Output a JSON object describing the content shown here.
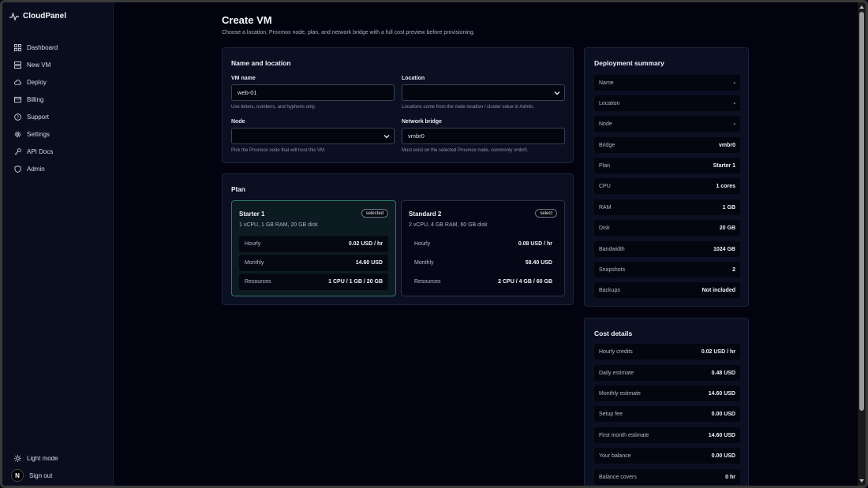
{
  "app": {
    "brand": "CloudPanel"
  },
  "sidebar": {
    "items": [
      {
        "label": "Dashboard",
        "icon": "grid-icon"
      },
      {
        "label": "New VM",
        "icon": "server-icon"
      },
      {
        "label": "Deploy",
        "icon": "cloud-icon"
      },
      {
        "label": "Billing",
        "icon": "card-icon"
      },
      {
        "label": "Support",
        "icon": "help-icon"
      },
      {
        "label": "Settings",
        "icon": "gear-icon"
      },
      {
        "label": "API Docs",
        "icon": "key-icon"
      },
      {
        "label": "Admin",
        "icon": "shield-icon"
      }
    ],
    "bottom": {
      "light_mode": "Light mode",
      "sign_out": "Sign out",
      "avatar_letter": "N"
    }
  },
  "header": {
    "title": "Create VM",
    "subtitle": "Choose a location, Proxmox node, plan, and network bridge with a full cost preview before provisioning."
  },
  "form": {
    "title": "Name and location",
    "vm_name": {
      "label": "VM name",
      "value": "web-01",
      "hint": "Use letters, numbers, and hyphens only."
    },
    "location": {
      "label": "Location",
      "value": "",
      "hint": "Locations come from the node location / cluster value in Admin."
    },
    "node": {
      "label": "Node",
      "value": "",
      "hint": "Pick the Proxmox node that will host this VM."
    },
    "bridge": {
      "label": "Network bridge",
      "value": "vmbr0",
      "hint": "Must exist on the selected Proxmox node, commonly vmbr0."
    }
  },
  "plans": {
    "title": "Plan",
    "items": [
      {
        "name": "Starter 1",
        "badge": "selected",
        "desc": "1 vCPU, 1 GB RAM, 20 GB disk",
        "rows": [
          {
            "k": "Hourly",
            "v": "0.02 USD / hr"
          },
          {
            "k": "Monthly",
            "v": "14.60 USD"
          },
          {
            "k": "Resources",
            "v": "1 CPU / 1 GB / 20 GB"
          }
        ]
      },
      {
        "name": "Standard 2",
        "badge": "select",
        "desc": "2 vCPU, 4 GB RAM, 60 GB disk",
        "rows": [
          {
            "k": "Hourly",
            "v": "0.08 USD / hr"
          },
          {
            "k": "Monthly",
            "v": "58.40 USD"
          },
          {
            "k": "Resources",
            "v": "2 CPU / 4 GB / 60 GB"
          }
        ]
      }
    ]
  },
  "summary": {
    "title": "Deployment summary",
    "rows": [
      {
        "k": "Name",
        "v": "-"
      },
      {
        "k": "Location",
        "v": "-"
      },
      {
        "k": "Node",
        "v": "-"
      },
      {
        "k": "Bridge",
        "v": "vmbr0"
      },
      {
        "k": "Plan",
        "v": "Starter 1"
      },
      {
        "k": "CPU",
        "v": "1 cores"
      },
      {
        "k": "RAM",
        "v": "1 GB"
      },
      {
        "k": "Disk",
        "v": "20 GB"
      },
      {
        "k": "Bandwidth",
        "v": "1024 GB"
      },
      {
        "k": "Snapshots",
        "v": "2"
      },
      {
        "k": "Backups",
        "v": "Not included"
      }
    ]
  },
  "costs": {
    "title": "Cost details",
    "rows": [
      {
        "k": "Hourly credits",
        "v": "0.02 USD / hr"
      },
      {
        "k": "Daily estimate",
        "v": "0.48 USD"
      },
      {
        "k": "Monthly estimate",
        "v": "14.60 USD"
      },
      {
        "k": "Setup fee",
        "v": "0.00 USD"
      },
      {
        "k": "First month estimate",
        "v": "14.60 USD"
      },
      {
        "k": "Your balance",
        "v": "0.00 USD"
      },
      {
        "k": "Balance covers",
        "v": "0 hr"
      }
    ]
  },
  "colors": {
    "accent": "#2a7a68",
    "background": "#02030f",
    "card": "#0b0f22"
  }
}
